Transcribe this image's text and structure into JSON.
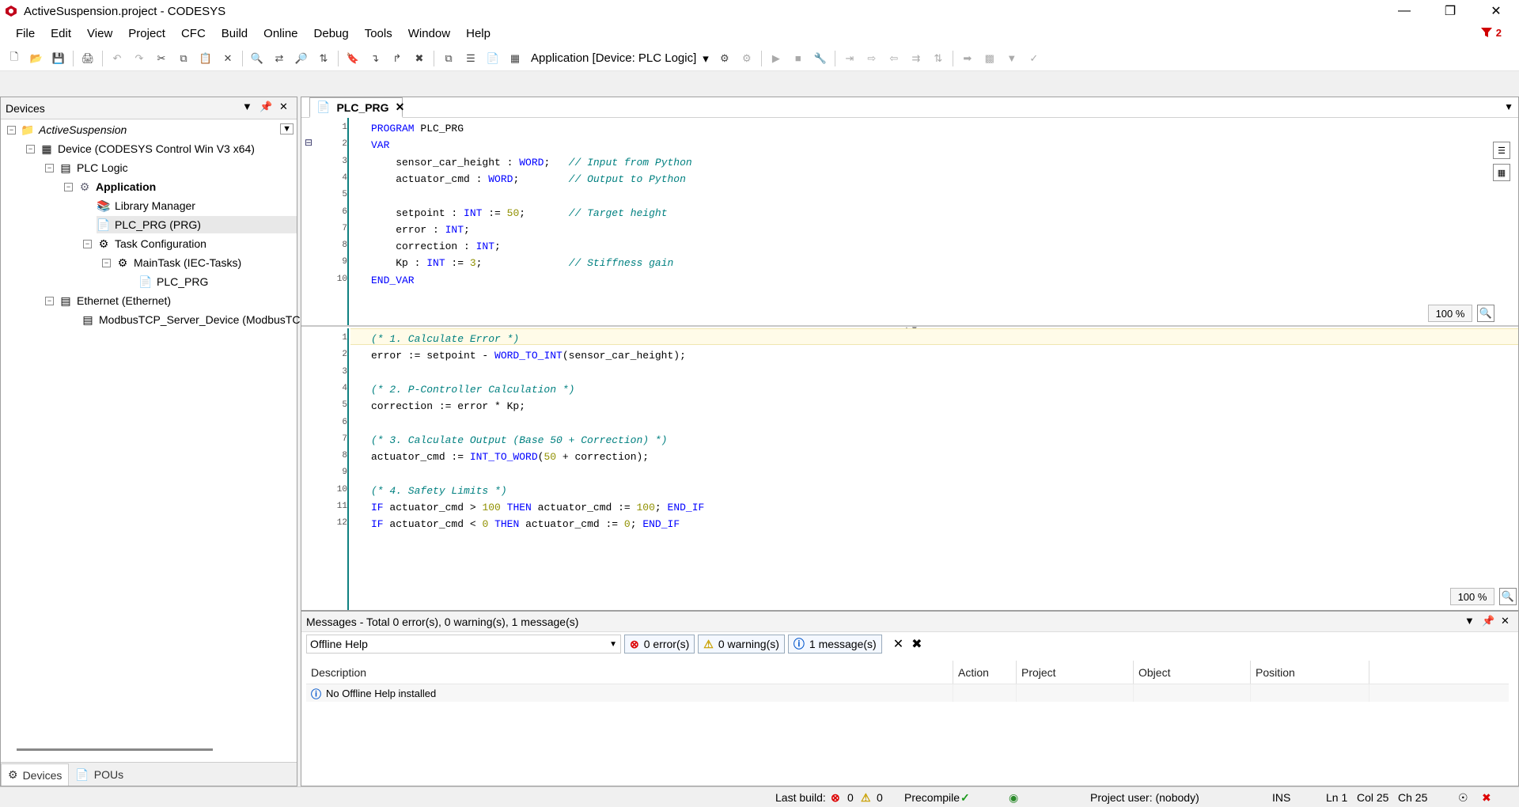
{
  "window": {
    "title": "ActiveSuspension.project - CODESYS"
  },
  "menu": [
    "File",
    "Edit",
    "View",
    "Project",
    "CFC",
    "Build",
    "Online",
    "Debug",
    "Tools",
    "Window",
    "Help"
  ],
  "alarm_count": "2",
  "toolbar": {
    "application_selector": "Application [Device: PLC Logic]"
  },
  "devices": {
    "title": "Devices",
    "tree": [
      {
        "label": "ActiveSuspension"
      },
      {
        "label": "Device (CODESYS Control Win V3 x64)"
      },
      {
        "label": "PLC Logic"
      },
      {
        "label": "Application"
      },
      {
        "label": "Library Manager"
      },
      {
        "label": "PLC_PRG (PRG)"
      },
      {
        "label": "Task Configuration"
      },
      {
        "label": "MainTask (IEC-Tasks)"
      },
      {
        "label": "PLC_PRG"
      },
      {
        "label": "Ethernet (Ethernet)"
      },
      {
        "label": "ModbusTCP_Server_Device (ModbusTC"
      }
    ],
    "bottom_tabs": [
      "Devices",
      "POUs"
    ]
  },
  "editor": {
    "tab": "PLC_PRG",
    "declaration_zoom": "100 %",
    "implementation_zoom": "100 %",
    "declaration_lines": [
      {
        "n": "1",
        "segs": [
          {
            "t": "PROGRAM",
            "c": "kw"
          },
          {
            "t": " PLC_PRG",
            "c": ""
          }
        ]
      },
      {
        "n": "2",
        "segs": [
          {
            "t": "VAR",
            "c": "kw"
          }
        ]
      },
      {
        "n": "3",
        "segs": [
          {
            "t": "    sensor_car_height : ",
            "c": ""
          },
          {
            "t": "WORD",
            "c": "kw"
          },
          {
            "t": ";   ",
            "c": ""
          },
          {
            "t": "// Input from Python",
            "c": "cm"
          }
        ]
      },
      {
        "n": "4",
        "segs": [
          {
            "t": "    actuator_cmd : ",
            "c": ""
          },
          {
            "t": "WORD",
            "c": "kw"
          },
          {
            "t": ";        ",
            "c": ""
          },
          {
            "t": "// Output to Python",
            "c": "cm"
          }
        ]
      },
      {
        "n": "5",
        "segs": []
      },
      {
        "n": "6",
        "segs": [
          {
            "t": "    setpoint : ",
            "c": ""
          },
          {
            "t": "INT",
            "c": "kw"
          },
          {
            "t": " := ",
            "c": ""
          },
          {
            "t": "50",
            "c": "num"
          },
          {
            "t": ";       ",
            "c": ""
          },
          {
            "t": "// Target height",
            "c": "cm"
          }
        ]
      },
      {
        "n": "7",
        "segs": [
          {
            "t": "    error : ",
            "c": ""
          },
          {
            "t": "INT",
            "c": "kw"
          },
          {
            "t": ";",
            "c": ""
          }
        ]
      },
      {
        "n": "8",
        "segs": [
          {
            "t": "    correction : ",
            "c": ""
          },
          {
            "t": "INT",
            "c": "kw"
          },
          {
            "t": ";",
            "c": ""
          }
        ]
      },
      {
        "n": "9",
        "segs": [
          {
            "t": "    Kp : ",
            "c": ""
          },
          {
            "t": "INT",
            "c": "kw"
          },
          {
            "t": " := ",
            "c": ""
          },
          {
            "t": "3",
            "c": "num"
          },
          {
            "t": ";              ",
            "c": ""
          },
          {
            "t": "// Stiffness gain",
            "c": "cm"
          }
        ]
      },
      {
        "n": "10",
        "segs": [
          {
            "t": "END_VAR",
            "c": "kw"
          }
        ]
      }
    ],
    "implementation_lines": [
      {
        "n": "1",
        "segs": [
          {
            "t": "(* 1. Calculate Error *)",
            "c": "cm"
          }
        ]
      },
      {
        "n": "2",
        "segs": [
          {
            "t": "error := setpoint - ",
            "c": ""
          },
          {
            "t": "WORD_TO_INT",
            "c": "kw"
          },
          {
            "t": "(sensor_car_height);",
            "c": ""
          }
        ]
      },
      {
        "n": "3",
        "segs": []
      },
      {
        "n": "4",
        "segs": [
          {
            "t": "(* 2. P-Controller Calculation *)",
            "c": "cm"
          }
        ]
      },
      {
        "n": "5",
        "segs": [
          {
            "t": "correction := error * Kp;",
            "c": ""
          }
        ]
      },
      {
        "n": "6",
        "segs": []
      },
      {
        "n": "7",
        "segs": [
          {
            "t": "(* 3. Calculate Output (Base 50 + Correction) *)",
            "c": "cm"
          }
        ]
      },
      {
        "n": "8",
        "segs": [
          {
            "t": "actuator_cmd := ",
            "c": ""
          },
          {
            "t": "INT_TO_WORD",
            "c": "kw"
          },
          {
            "t": "(",
            "c": ""
          },
          {
            "t": "50",
            "c": "num"
          },
          {
            "t": " + correction);",
            "c": ""
          }
        ]
      },
      {
        "n": "9",
        "segs": []
      },
      {
        "n": "10",
        "segs": [
          {
            "t": "(* 4. Safety Limits *)",
            "c": "cm"
          }
        ]
      },
      {
        "n": "11",
        "segs": [
          {
            "t": "IF",
            "c": "kw"
          },
          {
            "t": " actuator_cmd > ",
            "c": ""
          },
          {
            "t": "100",
            "c": "num"
          },
          {
            "t": " ",
            "c": ""
          },
          {
            "t": "THEN",
            "c": "kw"
          },
          {
            "t": " actuator_cmd := ",
            "c": ""
          },
          {
            "t": "100",
            "c": "num"
          },
          {
            "t": "; ",
            "c": ""
          },
          {
            "t": "END_IF",
            "c": "kw"
          }
        ]
      },
      {
        "n": "12",
        "segs": [
          {
            "t": "IF",
            "c": "kw"
          },
          {
            "t": " actuator_cmd < ",
            "c": ""
          },
          {
            "t": "0",
            "c": "num"
          },
          {
            "t": " ",
            "c": ""
          },
          {
            "t": "THEN",
            "c": "kw"
          },
          {
            "t": " actuator_cmd := ",
            "c": ""
          },
          {
            "t": "0",
            "c": "num"
          },
          {
            "t": "; ",
            "c": ""
          },
          {
            "t": "END_IF",
            "c": "kw"
          }
        ]
      }
    ]
  },
  "messages": {
    "title": "Messages - Total 0 error(s), 0 warning(s), 1 message(s)",
    "filter": "Offline Help",
    "errors": "0 error(s)",
    "warnings": "0 warning(s)",
    "infos": "1 message(s)",
    "columns": [
      "Description",
      "Action",
      "Project",
      "Object",
      "Position"
    ],
    "rows": [
      {
        "description": "No Offline Help installed"
      }
    ]
  },
  "status": {
    "last_build": "Last build:",
    "errors": "0",
    "warnings": "0",
    "precompile": "Precompile",
    "project_user": "Project user: (nobody)",
    "mode": "INS",
    "ln": "Ln 1",
    "col": "Col 25",
    "ch": "Ch 25"
  }
}
